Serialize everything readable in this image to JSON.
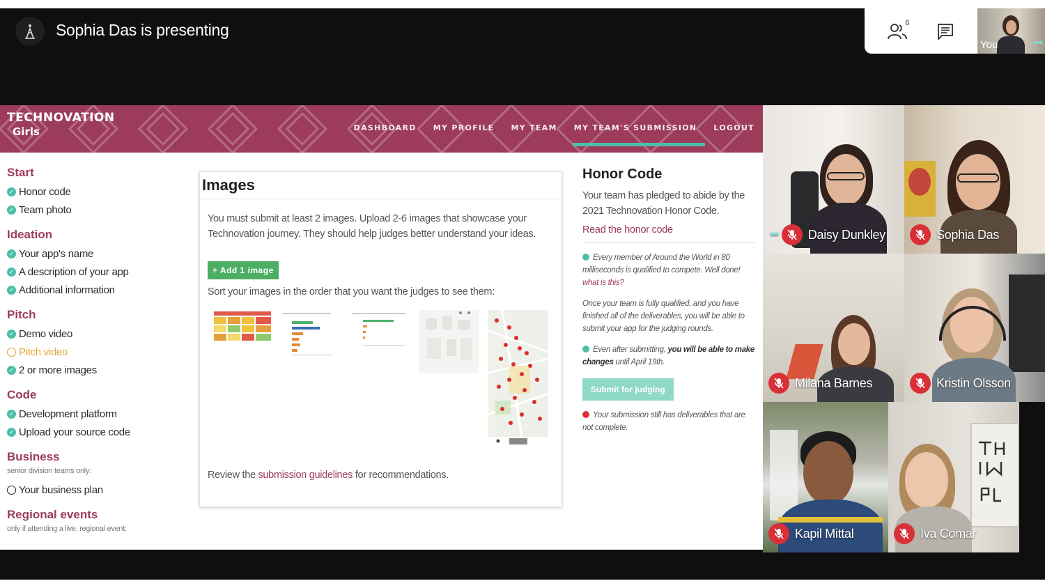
{
  "meet": {
    "presenting_label": "Sophia Das is presenting",
    "people_count": "6",
    "self_label": "You",
    "icons": [
      "presenter-icon",
      "people-icon",
      "chat-icon",
      "more-options-icon",
      "mic-off-icon"
    ],
    "colors": {
      "mute_red": "#d93038",
      "speaking_teal": "#7ee0d8",
      "controls_bg": "#ffffff"
    }
  },
  "site": {
    "brand_main": "TECHNOVATION",
    "brand_sub": "Girls",
    "nav": [
      "DASHBOARD",
      "MY PROFILE",
      "MY TEAM",
      "MY TEAM'S SUBMISSION",
      "LOGOUT"
    ],
    "active_nav": "MY TEAM'S SUBMISSION",
    "colors": {
      "brand": "#9c3b5a",
      "accent": "#4dbfa9",
      "button": "#4cae63",
      "pending": "#e3a73b"
    }
  },
  "sidebar": {
    "start_heading": "Start",
    "start_items": [
      "Honor code",
      "Team photo"
    ],
    "ideation_heading": "Ideation",
    "ideation_items": [
      "Your app's name",
      "A description of your app",
      "Additional information"
    ],
    "pitch_heading": "Pitch",
    "pitch_items": [
      "Demo video",
      "Pitch video",
      "2 or more images"
    ],
    "code_heading": "Code",
    "code_items": [
      "Development platform",
      "Upload your source code"
    ],
    "business_heading": "Business",
    "business_note": "senior division teams only:",
    "business_items": [
      "Your business plan"
    ],
    "regional_heading": "Regional events",
    "regional_note": "only if attending a live, regional event:"
  },
  "images_card": {
    "title": "Images",
    "description": "You must submit at least 2 images. Upload 2-6 images that showcase your Technovation journey. They should help judges better understand your ideas.",
    "add_button": "+ Add 1 image",
    "sort_text": "Sort your images in the order that you want the judges to see them:",
    "review_prefix": "Review the ",
    "review_link": "submission guidelines",
    "review_suffix": " for recommendations."
  },
  "honor": {
    "title": "Honor Code",
    "description": "Your team has pledged to abide by the 2021 Technovation Honor Code.",
    "link": "Read the honor code",
    "qualified_note": "Every member of Around the World in 80 milliseconds is qualified to compete. Well done!",
    "what_link": "what is this?",
    "judging_note": "Once your team is fully qualified, and you have finished all of the deliverables, you will be able to submit your app for the judging rounds.",
    "changes_prefix": "Even after submitting, ",
    "changes_bold": "you will be able to make changes",
    "changes_suffix": " until April 19th.",
    "submit_button": "Submit for judging",
    "incomplete_note": "Your submission still has deliverables that are not complete."
  },
  "participants": [
    {
      "name": "Daisy Dunkley",
      "muted": true,
      "speaking": true
    },
    {
      "name": "Sophia Das",
      "muted": true,
      "speaking": false
    },
    {
      "name": "Milana Barnes",
      "muted": true,
      "speaking": false
    },
    {
      "name": "Kristin Olsson",
      "muted": true,
      "speaking": false
    },
    {
      "name": "Kapil Mittal",
      "muted": true,
      "speaking": false
    },
    {
      "name": "Iva Comar",
      "muted": true,
      "speaking": false
    }
  ]
}
